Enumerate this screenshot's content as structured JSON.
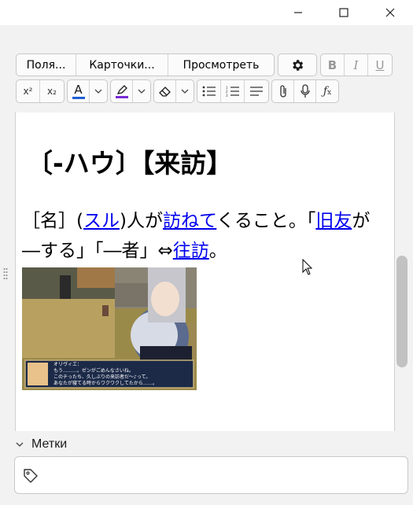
{
  "window": {
    "minimize_icon": "minimize-icon",
    "maximize_icon": "maximize-icon",
    "close_icon": "close-icon"
  },
  "toolbar": {
    "fields_label": "Поля...",
    "cards_label": "Карточки...",
    "preview_label": "Просмотреть",
    "settings_icon": "gear-icon",
    "bold_label": "B",
    "italic_label": "I",
    "underline_label": "U",
    "superscript_label": "x²",
    "subscript_label": "x₂",
    "text_color": "#1f5fd6",
    "highlight_color": "#7a2bd8"
  },
  "card": {
    "heading": "〔-ハウ〕【来訪】",
    "definition": {
      "p1": "［名］(",
      "link1": "スル",
      "p2": ")人が",
      "link2": "訪ねて",
      "p3": "くること。「",
      "link3": "旧友",
      "p4": "が―する」「―者」⇔",
      "link4": "往訪",
      "p5": "。"
    },
    "image": {
      "speaker": "オリヴィエ：",
      "line1": "もう………。ゼンがごめんなさいね。",
      "line2": "このチったち、久しぶりの来訪者だ〜♪って。",
      "line3": "あなたが寝てる時からワクワクしてたから……。"
    }
  },
  "tags": {
    "label": "Метки",
    "input_value": ""
  }
}
